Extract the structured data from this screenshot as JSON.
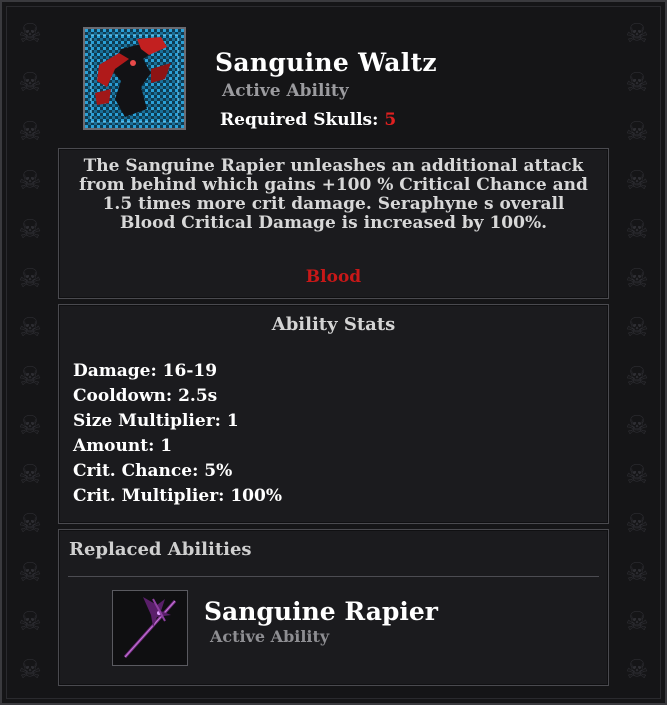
{
  "ability": {
    "name": "Sanguine Waltz",
    "type": "Active Ability",
    "required_skulls_label": "Required Skulls:",
    "required_skulls_value": "5"
  },
  "description": {
    "text": "The Sanguine Rapier unleashes an additional attack from behind which gains +100 % Critical Chance and 1.5 times more crit damage. Seraphyne s overall Blood Critical Damage is increased by 100%.",
    "tag": "Blood"
  },
  "stats": {
    "title": "Ability Stats",
    "items": [
      "Damage: 16-19",
      "Cooldown: 2.5s",
      "Size Multiplier: 1",
      "Amount: 1",
      "Crit. Chance: 5%",
      "Crit. Multiplier: 100%"
    ]
  },
  "replaced": {
    "title": "Replaced Abilities",
    "name": "Sanguine Rapier",
    "type": "Active Ability"
  },
  "colors": {
    "accent_red": "#e02020",
    "tag_red": "#c81818",
    "panel_border": "#4a4a4f"
  },
  "icons": [
    "skull-icon",
    "sanguine-waltz-portrait",
    "sanguine-rapier-icon"
  ]
}
